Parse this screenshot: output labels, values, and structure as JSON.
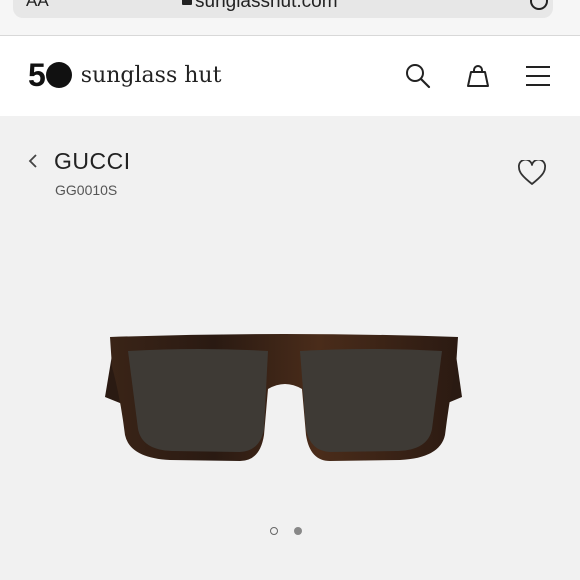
{
  "browser": {
    "reader_label": "AA",
    "url": "sunglasshut.com"
  },
  "header": {
    "logo_number": "5",
    "logo_text": "sunglass hut"
  },
  "product": {
    "brand": "GUCCI",
    "model": "GG0010S"
  },
  "carousel": {
    "total": 2,
    "active": 1
  },
  "colors": {
    "page_bg": "#f1f1f1",
    "header_bg": "#ffffff",
    "lens": "#3e3a35",
    "frame": "#2a1a12"
  },
  "icons": [
    "search-icon",
    "bag-icon",
    "menu-icon",
    "back-chevron-icon",
    "heart-icon",
    "lock-icon",
    "reload-icon"
  ]
}
